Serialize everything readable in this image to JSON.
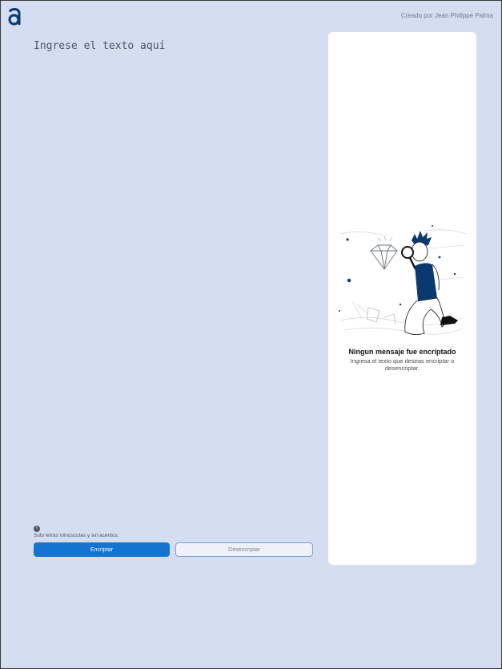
{
  "header": {
    "logo_icon": "alura-a-logo-icon",
    "credit": "Creado por Jean Philippe Palma"
  },
  "editor": {
    "placeholder": "Ingrese el texto aquí"
  },
  "hint": {
    "icon": "info-icon",
    "icon_glyph": "!",
    "text": "Solo letras minúsculas y sin acentos."
  },
  "buttons": {
    "encrypt": "Encriptar",
    "decrypt": "Desencriptar"
  },
  "output": {
    "illustration": "boy-with-magnifier-and-diamond-illustration",
    "empty_title": "Ningun mensaje fue encriptado",
    "empty_description": "Ingresa el texto que deseas encriptar o desencriptar."
  },
  "colors": {
    "background": "#d4def0",
    "primary": "#1674d1",
    "brand_dark": "#0a3871",
    "panel": "#ffffff"
  }
}
